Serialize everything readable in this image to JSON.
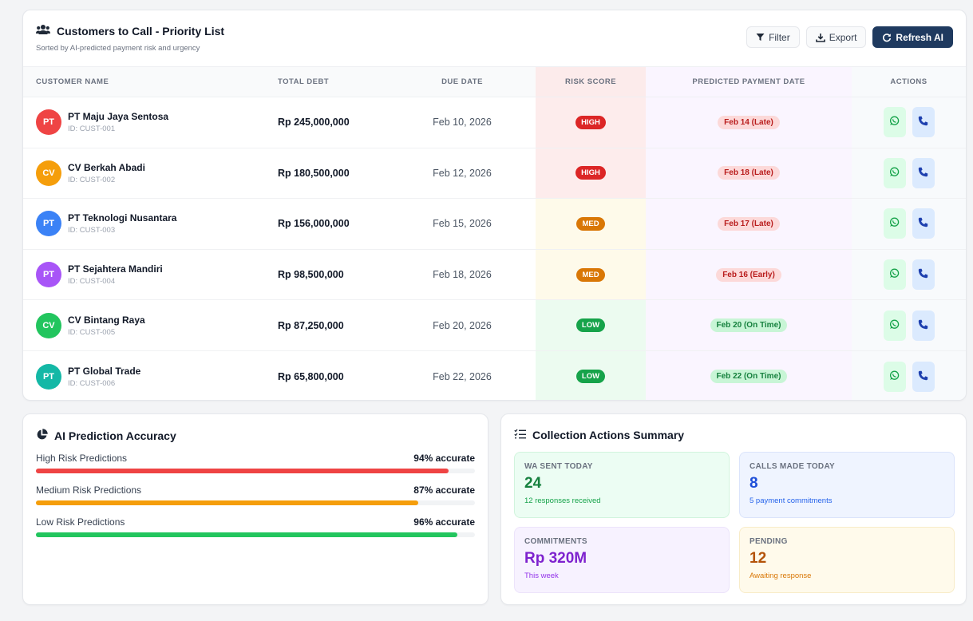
{
  "priority": {
    "title": "Customers to Call - Priority List",
    "subtitle": "Sorted by AI-predicted payment risk and urgency",
    "filter_label": "Filter",
    "export_label": "Export",
    "refresh_label": "Refresh AI",
    "columns": [
      "CUSTOMER NAME",
      "TOTAL DEBT",
      "DUE DATE",
      "RISK SCORE",
      "PREDICTED PAYMENT DATE",
      "ACTIONS"
    ],
    "rows": [
      {
        "initials": "PT",
        "avatar_color": "#ef4444",
        "name": "PT Maju Jaya Sentosa",
        "id": "ID: CUST-001",
        "debt": "Rp 245,000,000",
        "due": "Feb 10, 2026",
        "risk": "HIGH",
        "risk_level": "high",
        "predicted": "Feb 14 (Late)",
        "predicted_status": "late"
      },
      {
        "initials": "CV",
        "avatar_color": "#f59e0b",
        "name": "CV Berkah Abadi",
        "id": "ID: CUST-002",
        "debt": "Rp 180,500,000",
        "due": "Feb 12, 2026",
        "risk": "HIGH",
        "risk_level": "high",
        "predicted": "Feb 18 (Late)",
        "predicted_status": "late"
      },
      {
        "initials": "PT",
        "avatar_color": "#3b82f6",
        "name": "PT Teknologi Nusantara",
        "id": "ID: CUST-003",
        "debt": "Rp 156,000,000",
        "due": "Feb 15, 2026",
        "risk": "MED",
        "risk_level": "med",
        "predicted": "Feb 17 (Late)",
        "predicted_status": "late"
      },
      {
        "initials": "PT",
        "avatar_color": "#a855f7",
        "name": "PT Sejahtera Mandiri",
        "id": "ID: CUST-004",
        "debt": "Rp 98,500,000",
        "due": "Feb 18, 2026",
        "risk": "MED",
        "risk_level": "med",
        "predicted": "Feb 16 (Early)",
        "predicted_status": "late"
      },
      {
        "initials": "CV",
        "avatar_color": "#22c55e",
        "name": "CV Bintang Raya",
        "id": "ID: CUST-005",
        "debt": "Rp 87,250,000",
        "due": "Feb 20, 2026",
        "risk": "LOW",
        "risk_level": "low",
        "predicted": "Feb 20 (On Time)",
        "predicted_status": "ontime"
      },
      {
        "initials": "PT",
        "avatar_color": "#14b8a6",
        "name": "PT Global Trade",
        "id": "ID: CUST-006",
        "debt": "Rp 65,800,000",
        "due": "Feb 22, 2026",
        "risk": "LOW",
        "risk_level": "low",
        "predicted": "Feb 22 (On Time)",
        "predicted_status": "ontime"
      }
    ]
  },
  "risk_colors": {
    "high": "#dc2626",
    "med": "#d97706",
    "low": "#16a34a"
  },
  "accuracy": {
    "title": "AI Prediction Accuracy",
    "items": [
      {
        "label": "High Risk Predictions",
        "value_text": "94% accurate",
        "percent": 94,
        "color": "#ef4444"
      },
      {
        "label": "Medium Risk Predictions",
        "value_text": "87% accurate",
        "percent": 87,
        "color": "#f59e0b"
      },
      {
        "label": "Low Risk Predictions",
        "value_text": "96% accurate",
        "percent": 96,
        "color": "#22c55e"
      }
    ]
  },
  "summary": {
    "title": "Collection Actions Summary",
    "tiles": [
      {
        "label": "WA SENT TODAY",
        "value": "24",
        "note": "12 responses received",
        "tone": "green",
        "value_color": "#15803d",
        "note_color": "#16a34a"
      },
      {
        "label": "CALLS MADE TODAY",
        "value": "8",
        "note": "5 payment commitments",
        "tone": "blue",
        "value_color": "#1d4ed8",
        "note_color": "#2563eb"
      },
      {
        "label": "COMMITMENTS",
        "value": "Rp 320M",
        "note": "This week",
        "tone": "purple",
        "value_color": "#7e22ce",
        "note_color": "#9333ea"
      },
      {
        "label": "PENDING",
        "value": "12",
        "note": "Awaiting response",
        "tone": "amber",
        "value_color": "#b45309",
        "note_color": "#d97706"
      }
    ]
  }
}
